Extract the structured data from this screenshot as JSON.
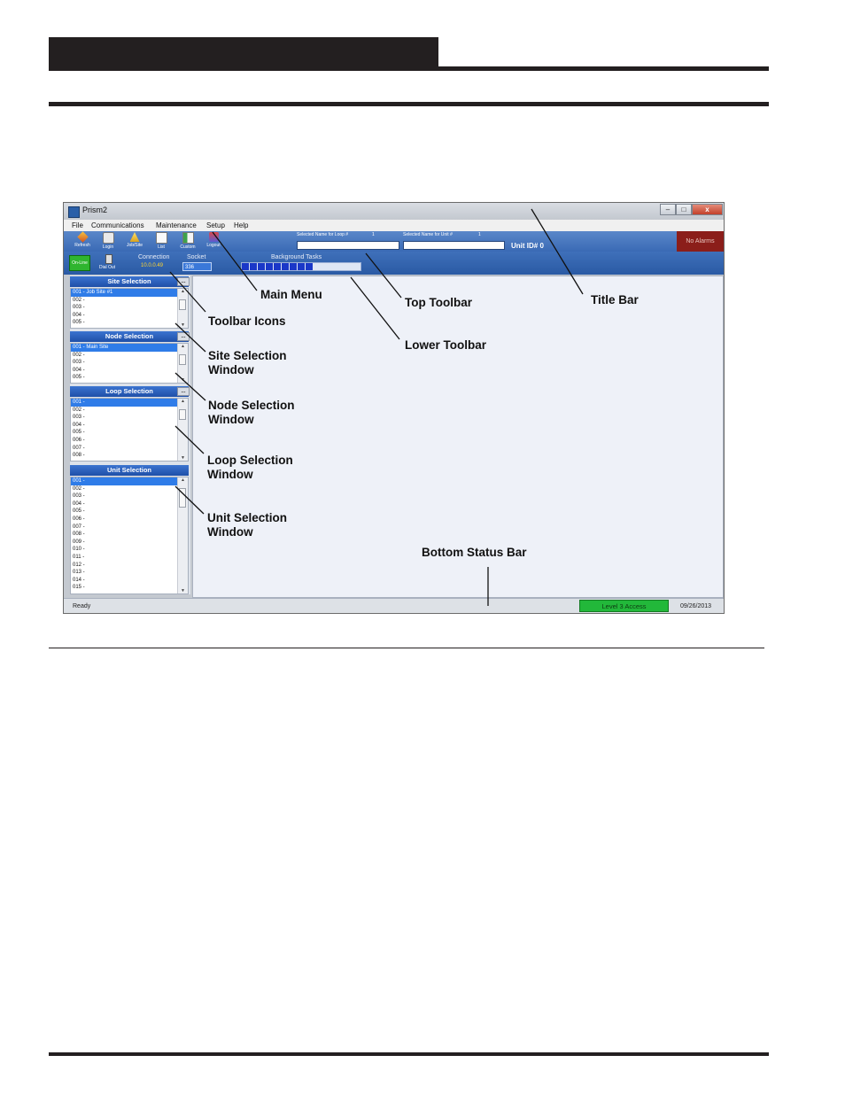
{
  "window": {
    "title": "Prism2",
    "controls": {
      "minimize": "–",
      "maximize": "□",
      "close": "x"
    },
    "menu": [
      "File",
      "Communications",
      "Maintenance",
      "Setup",
      "Help"
    ],
    "toolbar_icons": [
      {
        "icon": "refresh-icon",
        "label": "Refresh"
      },
      {
        "icon": "login-icon",
        "label": "Login"
      },
      {
        "icon": "job-site-icon",
        "label": "Job/Site"
      },
      {
        "icon": "list-icon",
        "label": "List"
      },
      {
        "icon": "custom-icon",
        "label": "Custom"
      },
      {
        "icon": "logout-icon",
        "label": "Logout"
      }
    ],
    "top_toolbar": {
      "loop_name_label": "Selected Name for Loop #",
      "loop_number": "1",
      "unit_name_label": "Selected Name for Unit #",
      "unit_number": "1",
      "unit_id": "Unit ID# 0",
      "alarms": "No Alarms"
    },
    "lower_toolbar": {
      "online": "On-Line",
      "dial_out": "Dial Out",
      "connection_label": "Connection",
      "connection_value": "10.0.0.49",
      "socket_label": "Socket",
      "socket_value": "336",
      "background_tasks_label": "Background Tasks",
      "background_tasks_progress": 0.6
    },
    "panels": {
      "site": {
        "title": "Site Selection",
        "items": [
          "001 - Job Site #1",
          "002 -",
          "003 -",
          "004 -",
          "005 -"
        ]
      },
      "node": {
        "title": "Node Selection",
        "items": [
          "001 - Main Site",
          "002 -",
          "003 -",
          "004 -",
          "005 -"
        ]
      },
      "loop": {
        "title": "Loop Selection",
        "items": [
          "001 -",
          "002 -",
          "003 -",
          "004 -",
          "005 -",
          "006 -",
          "007 -",
          "008 -"
        ]
      },
      "unit": {
        "title": "Unit Selection",
        "items": [
          "001 -",
          "002 -",
          "003 -",
          "004 -",
          "005 -",
          "006 -",
          "007 -",
          "008 -",
          "009 -",
          "010 -",
          "011 -",
          "012 -",
          "013 -",
          "014 -",
          "015 -"
        ]
      },
      "dots_label": "..."
    },
    "status_bar": {
      "status": "Ready",
      "access": "Level 3 Access",
      "date": "09/26/2013"
    }
  },
  "callouts": {
    "main_menu": "Main Menu",
    "top_toolbar": "Top Toolbar",
    "title_bar": "Title Bar",
    "toolbar_icons": "Toolbar Icons",
    "lower_toolbar": "Lower Toolbar",
    "site_selection_1": "Site Selection",
    "site_selection_2": "Window",
    "node_selection_1": "Node Selection",
    "node_selection_2": "Window",
    "loop_selection_1": "Loop Selection",
    "loop_selection_2": "Window",
    "unit_selection_1": "Unit Selection",
    "unit_selection_2": "Window",
    "bottom_status_bar": "Bottom Status Bar"
  }
}
